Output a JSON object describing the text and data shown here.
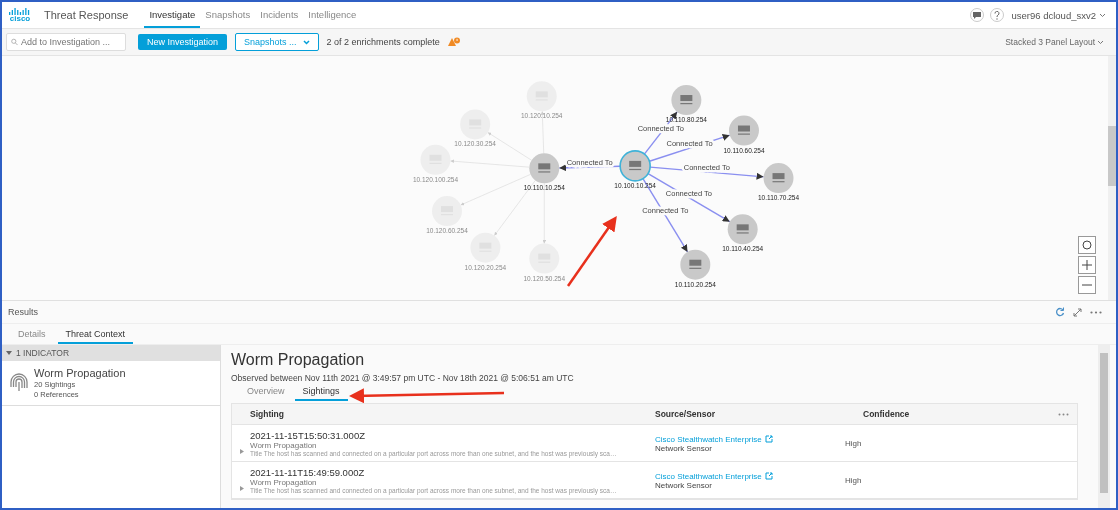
{
  "header": {
    "logo_text": "cisco",
    "app_title": "Threat Response",
    "nav": [
      {
        "label": "Investigate",
        "selected": true
      },
      {
        "label": "Snapshots",
        "selected": false
      },
      {
        "label": "Incidents",
        "selected": false
      },
      {
        "label": "Intelligence",
        "selected": false
      }
    ],
    "user": "user96 dcloud_sxv2"
  },
  "toolbar": {
    "search": {
      "placeholder": "Add to Investigation ..."
    },
    "new_button": "New Investigation",
    "snapshots_button": "Snapshots ...",
    "status": "2 of 2 enrichments complete",
    "layout_menu": "Stacked 3 Panel Layout"
  },
  "graph": {
    "nodes": [
      {
        "label": "10.100.10.254",
        "selected": true,
        "faded": false
      },
      {
        "label": "10.110.10.254",
        "selected": false,
        "faded": false
      },
      {
        "label": "10.110.80.254",
        "selected": false,
        "faded": false
      },
      {
        "label": "10.110.60.254",
        "selected": false,
        "faded": false
      },
      {
        "label": "10.110.70.254",
        "selected": false,
        "faded": false
      },
      {
        "label": "10.110.40.254",
        "selected": false,
        "faded": false
      },
      {
        "label": "10.110.20.254",
        "selected": false,
        "faded": false
      },
      {
        "label": "10.120.10.254",
        "selected": false,
        "faded": true
      },
      {
        "label": "10.120.30.254",
        "selected": false,
        "faded": true
      },
      {
        "label": "10.120.100.254",
        "selected": false,
        "faded": true
      },
      {
        "label": "10.120.60.254",
        "selected": false,
        "faded": true
      },
      {
        "label": "10.120.20.254",
        "selected": false,
        "faded": true
      },
      {
        "label": "10.120.50.254",
        "selected": false,
        "faded": true
      }
    ],
    "edges": [
      {
        "label": "Connected To"
      },
      {
        "label": "Connected To"
      },
      {
        "label": "Connected To"
      },
      {
        "label": "Connected To"
      },
      {
        "label": "Connected To"
      },
      {
        "label": "Connected To"
      }
    ]
  },
  "results": {
    "title": "Results",
    "tabs": [
      {
        "label": "Details",
        "selected": false
      },
      {
        "label": "Threat Context",
        "selected": true
      }
    ],
    "indicator_group": {
      "label": "1 INDICATOR",
      "expanded": true
    },
    "indicator": {
      "title": "Worm Propagation",
      "sightings": "20 Sightings",
      "references": "0 References"
    },
    "detail": {
      "title": "Worm Propagation",
      "observed": "Observed between Nov 11th 2021 @ 3:49:57 pm UTC - Nov 18th 2021 @ 5:06:51 am UTC",
      "tabs": [
        {
          "label": "Overview",
          "selected": false
        },
        {
          "label": "Sightings",
          "selected": true
        }
      ],
      "table": {
        "columns": [
          "Sighting",
          "Source/Sensor",
          "Confidence"
        ],
        "rows": [
          {
            "time": "2021-11-15T15:50:31.000Z",
            "title": "Worm Propagation",
            "description": "Title The host has scanned and connected on a particular port across more than one subnet, and the host was previously sca…",
            "source": "Cisco Stealthwatch Enterprise",
            "sensor": "Network Sensor",
            "confidence": "High"
          },
          {
            "time": "2021-11-11T15:49:59.000Z",
            "title": "Worm Propagation",
            "description": "Title The host has scanned and connected on a particular port across more than one subnet, and the host was previously sca…",
            "source": "Cisco Stealthwatch Enterprise",
            "sensor": "Network Sensor",
            "confidence": "High"
          }
        ]
      }
    }
  }
}
